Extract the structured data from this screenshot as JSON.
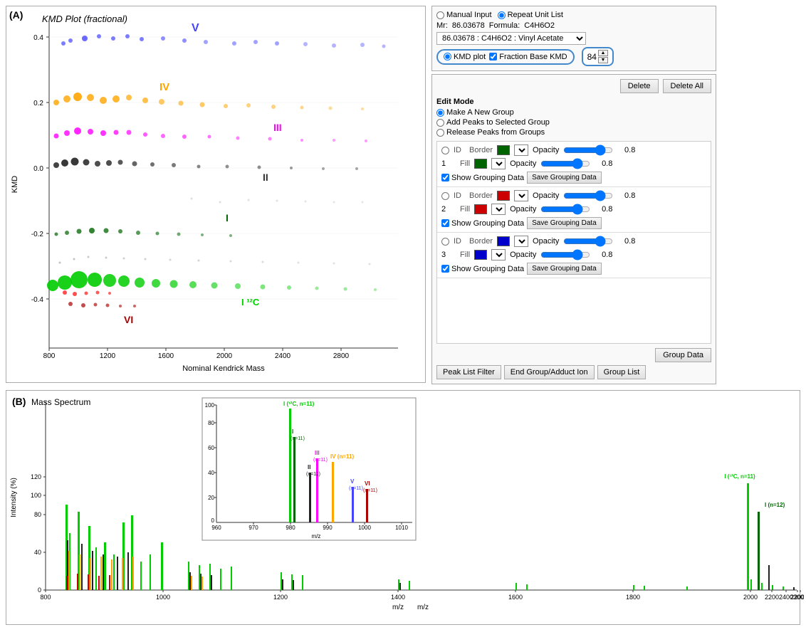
{
  "app": {
    "panel_a_label": "(A)",
    "panel_b_label": "(B)",
    "plot_title": "KMD Plot (fractional)",
    "spectrum_title": "Mass Spectrum",
    "x_axis_label": "Nominal Kendrick Mass",
    "y_axis_label": "KMD",
    "spectrum_x_label": "m/z",
    "spectrum_y_label": "Intensity (%)"
  },
  "input_panel": {
    "manual_input_label": "Manual Input",
    "repeat_unit_label": "Repeat Unit List",
    "mr_label": "Mr:",
    "mr_value": "86.03678",
    "formula_label": "Formula:",
    "formula_value": "C4H6O2",
    "dropdown_value": "86.03678 : C4H6O2 : Vinyl Acetate",
    "kmd_plot_label": "KMD plot",
    "fraction_base_label": "Fraction Base KMD",
    "spinner_value": "84"
  },
  "controls": {
    "delete_label": "Delete",
    "delete_all_label": "Delete All",
    "edit_mode_title": "Edit Mode",
    "make_new_group_label": "Make A New Group",
    "add_peaks_label": "Add Peaks to Selected Group",
    "release_peaks_label": "Release Peaks from Groups"
  },
  "groups": [
    {
      "id": "1",
      "border_color": "green",
      "fill_color": "green",
      "opacity_border": "0.8",
      "opacity_fill": "0.8",
      "show_label": "Show Grouping Data",
      "save_label": "Save Grouping Data"
    },
    {
      "id": "2",
      "border_color": "red",
      "fill_color": "red",
      "opacity_border": "0.8",
      "opacity_fill": "0.8",
      "show_label": "Show Grouping Data",
      "save_label": "Save Grouping Data"
    },
    {
      "id": "3",
      "border_color": "blue",
      "fill_color": "blue",
      "opacity_border": "0.8",
      "opacity_fill": "0.8",
      "show_label": "Show Grouping Data",
      "save_label": "Save Grouping Data"
    }
  ],
  "tabs": {
    "peak_list_filter": "Peak List Filter",
    "end_group": "End Group/Adduct Ion",
    "group_list": "Group List",
    "group_data": "Group Data"
  },
  "plot_labels": {
    "v": "V",
    "iv": "IV",
    "iii": "III",
    "ii": "II",
    "i": "I",
    "i_12c": "I ¹²C",
    "vi": "VI"
  }
}
